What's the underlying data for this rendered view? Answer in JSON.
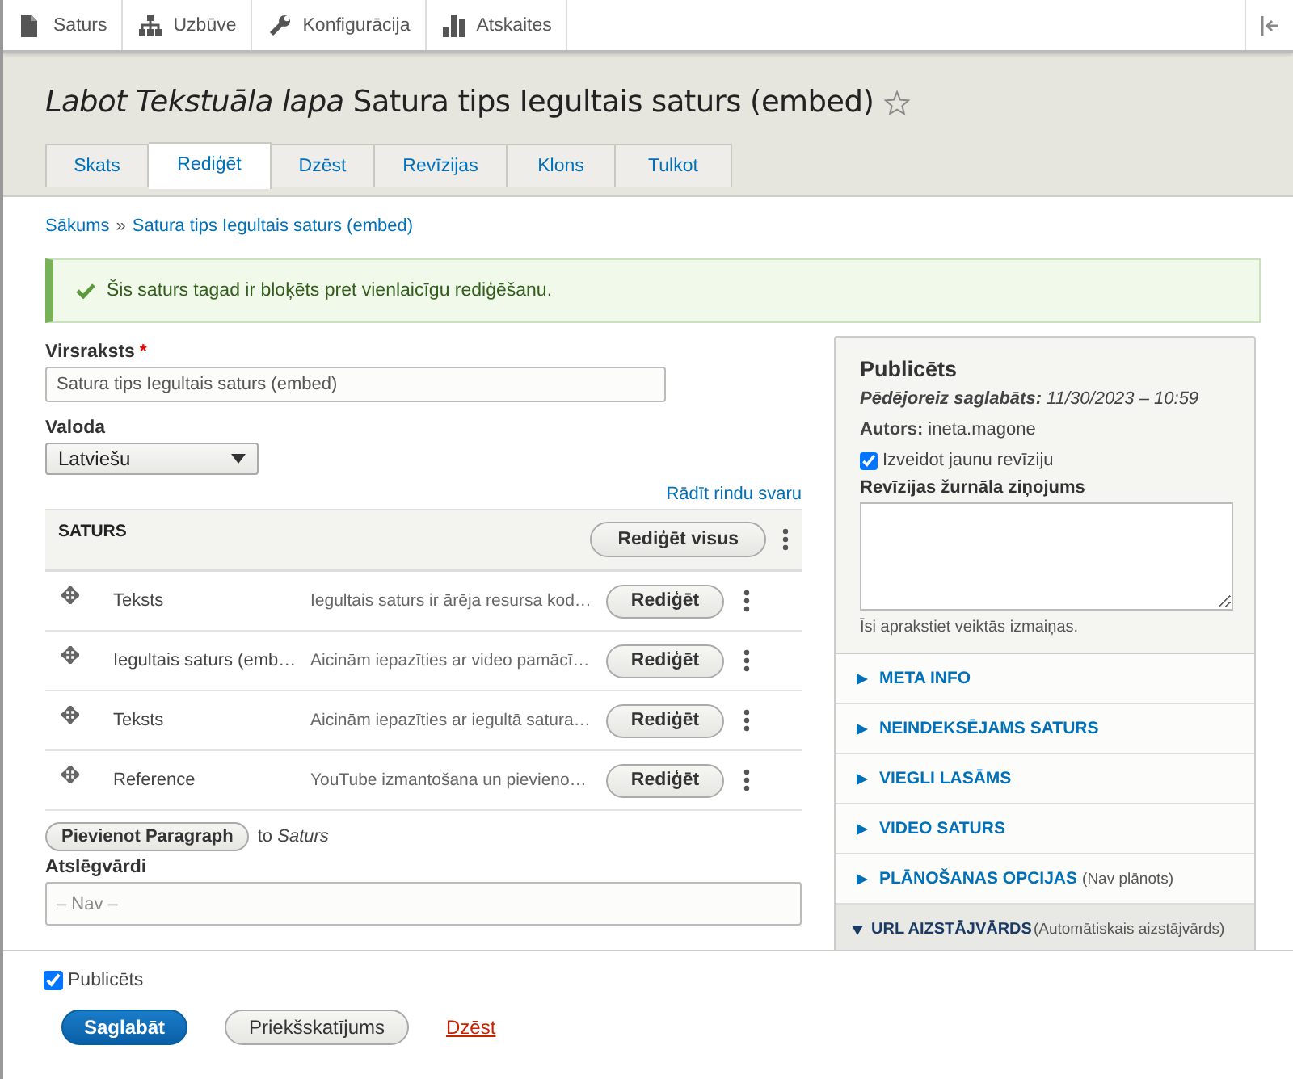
{
  "toolbar": [
    {
      "label": "Saturs"
    },
    {
      "label": "Uzbūve"
    },
    {
      "label": "Konfigurācija"
    },
    {
      "label": "Atskaites"
    }
  ],
  "page_title": "*Labot Tekstuāla lapa* Satura tips Iegultais saturs (embed)",
  "tabs": [
    {
      "label": "Skats",
      "selected": false
    },
    {
      "label": "Rediģēt",
      "selected": true
    },
    {
      "label": "Dzēst",
      "selected": false
    },
    {
      "label": "Revīzijas",
      "selected": false
    },
    {
      "label": "Klons",
      "selected": false
    },
    {
      "label": "Tulkot",
      "selected": false
    }
  ],
  "breadcrumb": {
    "items": [
      "Sākums",
      "Satura tips Iegultais saturs (embed)"
    ],
    "separator": "»"
  },
  "message": "Šis saturs tagad ir bloķēts pret vienlaicīgu rediģēšanu.",
  "title_field": {
    "label": "Virsraksts",
    "required_marker": "*",
    "value": "Satura tips Iegultais saturs (embed)"
  },
  "language_field": {
    "label": "Valoda",
    "value": "Latviešu"
  },
  "weights_link": "Rādīt rindu svaru",
  "paragraphs": {
    "heading": "SATURS",
    "edit_all": "Rediģēt visus",
    "rows": [
      {
        "type": "Teksts",
        "summary": "Iegultais saturs ir ārēja resursa kod…",
        "button": "Rediģēt"
      },
      {
        "type": "Iegultais saturs (emb…",
        "summary": "Aicinām iepazīties ar video pamācī…",
        "button": "Rediģēt"
      },
      {
        "type": "Teksts",
        "summary": "Aicinām iepazīties ar iegultā satura…",
        "button": "Rediģēt"
      },
      {
        "type": "Reference",
        "summary": "YouTube izmantošana un pievieno…",
        "button": "Rediģēt"
      }
    ],
    "add_button": "Pievienot Paragraph",
    "add_target": "to *Saturs*"
  },
  "keywords_field": {
    "label": "Atslēgvārdi",
    "placeholder": "– Nav –"
  },
  "sidebar": {
    "status": "Publicēts",
    "last_saved": "**Pēdējoreiz saglabāts:** 11/30/2023 – 10:59",
    "author": "**Autors:** ineta.magone",
    "new_revision": {
      "label": "Izveidot jaunu revīziju",
      "checked": true
    },
    "log_label": "Revīzijas žurnāla ziņojums",
    "log_hint": "Īsi aprakstiet veiktās izmaiņas.",
    "sections": [
      {
        "title": "META INFO",
        "expanded": false
      },
      {
        "title": "NEINDEKSĒJAMS SATURS",
        "expanded": false
      },
      {
        "title": "VIEGLI LASĀMS",
        "expanded": false
      },
      {
        "title": "VIDEO SATURS",
        "expanded": false
      },
      {
        "title": "PLĀNOŠANAS OPCIJAS",
        "summary": "(Nav plānots)",
        "expanded": false
      },
      {
        "title": "URL AIZSTĀJVĀRDS",
        "summary": "(Automātiskais aizstājvārds)",
        "expanded": true
      }
    ]
  },
  "footer": {
    "published": {
      "label": "Publicēts",
      "checked": true
    },
    "save": "Saglabāt",
    "preview": "Priekšskatījums",
    "delete": "Dzēst"
  }
}
